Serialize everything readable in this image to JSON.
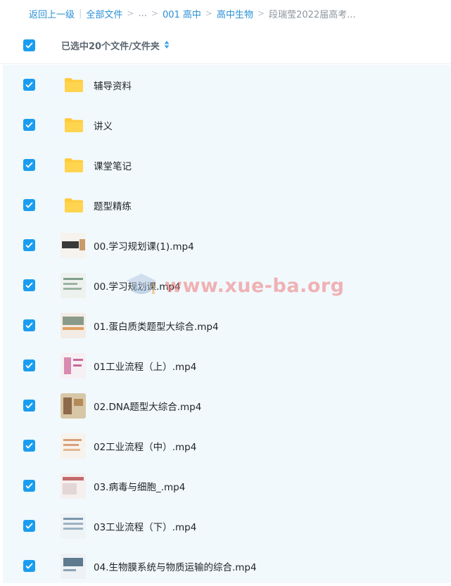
{
  "breadcrumb": {
    "back": "返回上一级",
    "all_files": "全部文件",
    "ellipsis": "...",
    "level1": "001 高中",
    "level2": "高中生物",
    "current": "段瑞莹2022届高考..."
  },
  "header": {
    "selection_label": "已选中20个文件/文件夹"
  },
  "files": [
    {
      "name": "辅导资料",
      "type": "folder"
    },
    {
      "name": "讲义",
      "type": "folder"
    },
    {
      "name": "课堂笔记",
      "type": "folder"
    },
    {
      "name": "题型精练",
      "type": "folder"
    },
    {
      "name": "00.学习规划课(1).mp4",
      "type": "video",
      "thumb": "a"
    },
    {
      "name": "00.学习规划课.mp4",
      "type": "video",
      "thumb": "b"
    },
    {
      "name": "01.蛋白质类题型大综合.mp4",
      "type": "video",
      "thumb": "c"
    },
    {
      "name": "01工业流程（上）.mp4",
      "type": "video",
      "thumb": "d"
    },
    {
      "name": "02.DNA题型大综合.mp4",
      "type": "video",
      "thumb": "e"
    },
    {
      "name": "02工业流程（中）.mp4",
      "type": "video",
      "thumb": "f"
    },
    {
      "name": "03.病毒与细胞_.mp4",
      "type": "video",
      "thumb": "g"
    },
    {
      "name": "03工业流程（下）.mp4",
      "type": "video",
      "thumb": "h"
    },
    {
      "name": "04.生物膜系统与物质运输的综合.mp4",
      "type": "video",
      "thumb": "i"
    }
  ],
  "watermark": "www.xue-ba.org",
  "colors": {
    "accent": "#1a9df0",
    "link": "#2a8fd6",
    "folder": "#ffcb3d",
    "list_bg": "#f1f9fd"
  }
}
